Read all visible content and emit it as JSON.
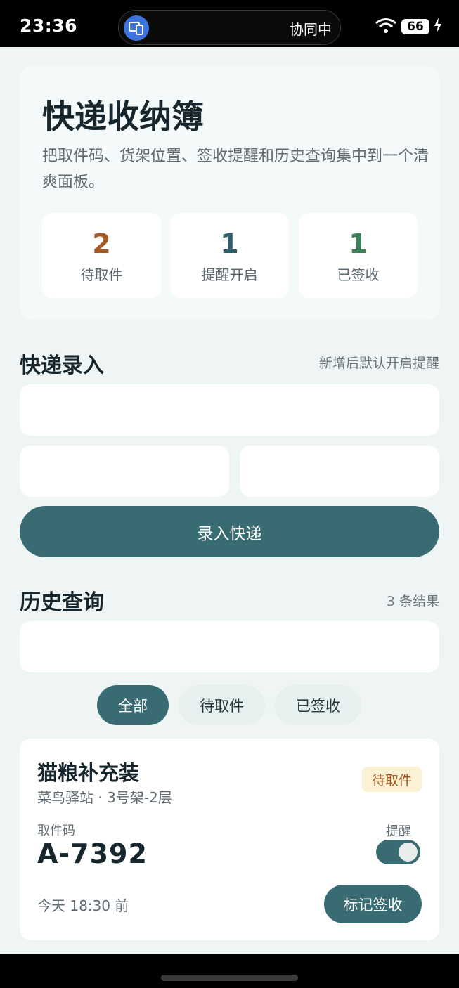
{
  "status_bar": {
    "time": "23:36",
    "pill_label": "协同中",
    "pill_icon": "multi-device-icon",
    "battery": "66"
  },
  "hero": {
    "title": "快递收纳簿",
    "subtitle": "把取件码、货架位置、签收提醒和历史查询集中到一个清爽面板。",
    "stats": [
      {
        "value": "2",
        "label": "待取件",
        "color": "#a45b27"
      },
      {
        "value": "1",
        "label": "提醒开启",
        "color": "#2e5f6a"
      },
      {
        "value": "1",
        "label": "已签收",
        "color": "#3b8056"
      }
    ]
  },
  "entry": {
    "title": "快递录入",
    "note": "新增后默认开启提醒",
    "submit_label": "录入快递"
  },
  "history": {
    "title": "历史查询",
    "count_text": "3 条结果",
    "filters": [
      {
        "label": "全部",
        "active": true
      },
      {
        "label": "待取件",
        "active": false
      },
      {
        "label": "已签收",
        "active": false
      }
    ]
  },
  "cards": [
    {
      "title": "猫粮补充装",
      "location": "菜鸟驿站 · 3号架-2层",
      "status": "待取件",
      "code_label": "取件码",
      "code": "A-7392",
      "remind_label": "提醒",
      "remind_on": true,
      "time": "今天 18:30 前",
      "action_label": "标记签收"
    }
  ],
  "colors": {
    "accent": "#386b72",
    "background": "#eef5f4",
    "badge_bg": "#fbf1d4",
    "badge_text": "#a2581e"
  }
}
